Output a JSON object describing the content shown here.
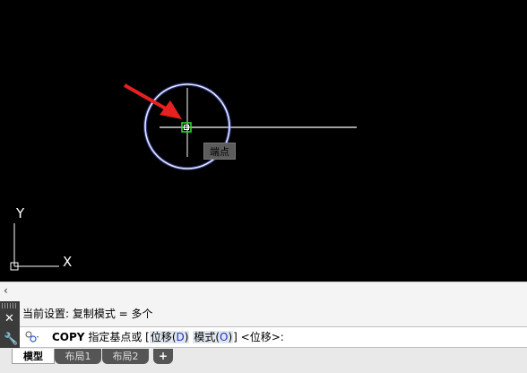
{
  "canvas": {
    "axis_labels": {
      "y": "Y",
      "x": "X"
    },
    "snap_tooltip": "端点"
  },
  "colors": {
    "background": "#000000",
    "line": "#ffffff",
    "circle": "#c8d0ff",
    "snap_marker": "#2bd52b",
    "arrow": "#e82020"
  },
  "command": {
    "collapse_icon": "chevron-left-icon",
    "history_line": "当前设置:  复制模式 = 多个",
    "command_name": "COPY",
    "prompt_text": "指定基点或",
    "bracket_open": "[",
    "options": [
      {
        "label": "位移(",
        "key": "D",
        "close": ")"
      },
      {
        "label": "模式(",
        "key": "O",
        "close": ")"
      }
    ],
    "bracket_close": "]",
    "default_text": "<位移>:"
  },
  "tabs": [
    {
      "label": "模型",
      "active": true
    },
    {
      "label": "布局1",
      "active": false
    },
    {
      "label": "布局2",
      "active": false
    }
  ],
  "tab_add_label": "+"
}
